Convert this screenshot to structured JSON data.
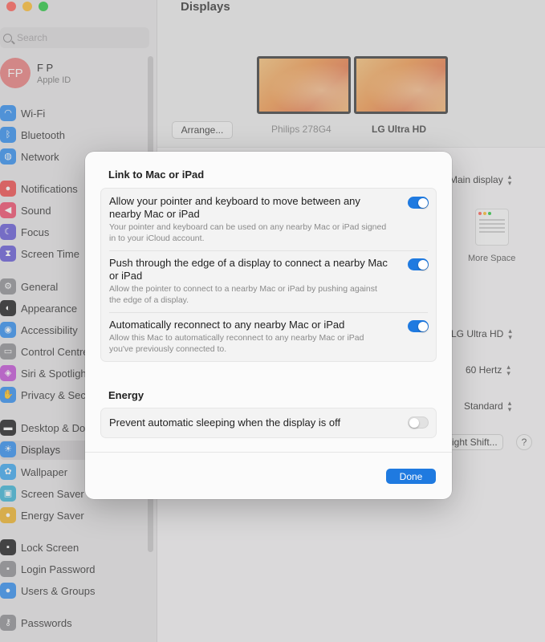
{
  "window": {
    "title": "Displays",
    "search_placeholder": "Search"
  },
  "account": {
    "initials": "FP",
    "name": "F P",
    "subtitle": "Apple ID"
  },
  "sidebar": {
    "items": [
      {
        "label": "Wi-Fi",
        "icon": "wifi-icon",
        "color": "#2f8df0"
      },
      {
        "label": "Bluetooth",
        "icon": "bluetooth-icon",
        "color": "#2f8df0"
      },
      {
        "label": "Network",
        "icon": "globe-icon",
        "color": "#2f8df0"
      },
      {
        "label": "Notifications",
        "icon": "bell-icon",
        "color": "#ef4b4b"
      },
      {
        "label": "Sound",
        "icon": "speaker-icon",
        "color": "#ef4b6a"
      },
      {
        "label": "Focus",
        "icon": "moon-icon",
        "color": "#6458d6"
      },
      {
        "label": "Screen Time",
        "icon": "hourglass-icon",
        "color": "#6458d6"
      },
      {
        "label": "General",
        "icon": "gear-icon",
        "color": "#8e8e93"
      },
      {
        "label": "Appearance",
        "icon": "appearance-icon",
        "color": "#1c1c1e"
      },
      {
        "label": "Accessibility",
        "icon": "accessibility-icon",
        "color": "#2f8df0"
      },
      {
        "label": "Control Centre",
        "icon": "control-centre-icon",
        "color": "#8e8e93"
      },
      {
        "label": "Siri & Spotlight",
        "icon": "siri-icon",
        "color": "#c24fd6"
      },
      {
        "label": "Privacy & Security",
        "icon": "hand-icon",
        "color": "#2f8df0"
      },
      {
        "label": "Desktop & Dock",
        "icon": "dock-icon",
        "color": "#1c1c1e"
      },
      {
        "label": "Displays",
        "icon": "sun-icon",
        "color": "#2f8df0"
      },
      {
        "label": "Wallpaper",
        "icon": "flower-icon",
        "color": "#3aa7f0"
      },
      {
        "label": "Screen Saver",
        "icon": "screen-saver-icon",
        "color": "#3ab4d6"
      },
      {
        "label": "Energy Saver",
        "icon": "lightbulb-icon",
        "color": "#f0b429"
      },
      {
        "label": "Lock Screen",
        "icon": "lock-icon",
        "color": "#1c1c1e"
      },
      {
        "label": "Login Password",
        "icon": "padlock-icon",
        "color": "#8e8e93"
      },
      {
        "label": "Users & Groups",
        "icon": "users-icon",
        "color": "#2f8df0"
      },
      {
        "label": "Passwords",
        "icon": "key-icon",
        "color": "#8e8e93"
      }
    ]
  },
  "displays": {
    "arrange_label": "Arrange...",
    "monitors": [
      {
        "name": "Philips 278G4"
      },
      {
        "name": "LG Ultra HD"
      }
    ],
    "use_as": "Main display",
    "more_space": "More Space",
    "mirror_target": "LG Ultra HD",
    "refresh_rate": "60 Hertz",
    "rotation": "Standard",
    "night_shift": "ight Shift...",
    "help": "?"
  },
  "sheet": {
    "section1_title": "Link to Mac or iPad",
    "link_rows": [
      {
        "title": "Allow your pointer and keyboard to move between any nearby Mac or iPad",
        "desc": "Your pointer and keyboard can be used on any nearby Mac or iPad signed in to your iCloud account.",
        "on": true
      },
      {
        "title": "Push through the edge of a display to connect a nearby Mac or iPad",
        "desc": "Allow the pointer to connect to a nearby Mac or iPad by pushing against the edge of a display.",
        "on": true
      },
      {
        "title": "Automatically reconnect to any nearby Mac or iPad",
        "desc": "Allow this Mac to automatically reconnect to any nearby Mac or iPad you've previously connected to.",
        "on": true
      }
    ],
    "section2_title": "Energy",
    "energy_rows": [
      {
        "title": "Prevent automatic sleeping when the display is off",
        "on": false
      }
    ],
    "done_label": "Done"
  }
}
